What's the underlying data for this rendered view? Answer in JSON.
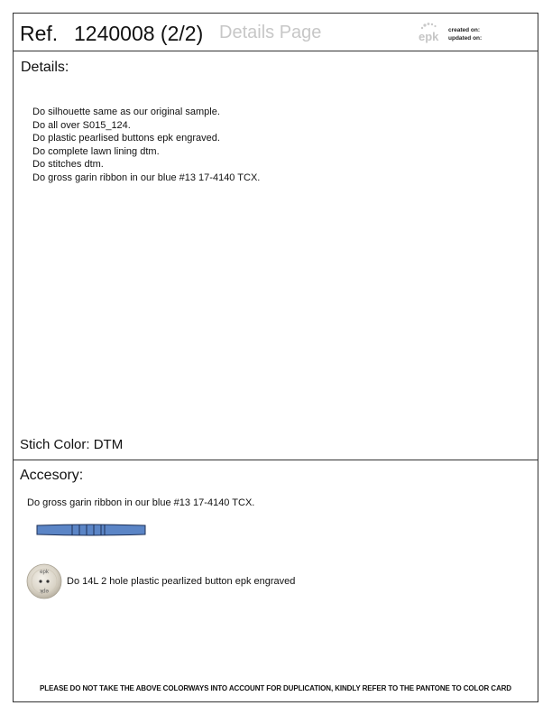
{
  "header": {
    "ref_prefix": "Ref.",
    "ref_number": "1240008 (2/2)",
    "page_subtitle": "Details Page",
    "brand_logo_icon": "epk-logo",
    "created_label": "created on:",
    "updated_label": "updated on:"
  },
  "details": {
    "title": "Details:",
    "items": [
      "Do silhouette same as our original sample.",
      "Do all over S015_124.",
      "Do plastic pearlised buttons epk engraved.",
      "Do complete lawn lining dtm.",
      "Do stitches dtm.",
      "Do gross garin ribbon in our blue #13 17-4140 TCX."
    ],
    "stitch_color_line": "Stich Color: DTM"
  },
  "accessory": {
    "title": "Accesory:",
    "ribbon_text": "Do gross garin ribbon in our blue #13 17-4140 TCX.",
    "ribbon_color": "#5b85c6",
    "button_text": "Do 14L 2 hole plastic pearlized button epk engraved",
    "button_engraving": "epk"
  },
  "footer": {
    "disclaimer": "PLEASE DO NOT TAKE THE ABOVE COLORWAYS INTO ACCOUNT FOR DUPLICATION, KINDLY REFER TO THE PANTONE TO COLOR CARD"
  }
}
